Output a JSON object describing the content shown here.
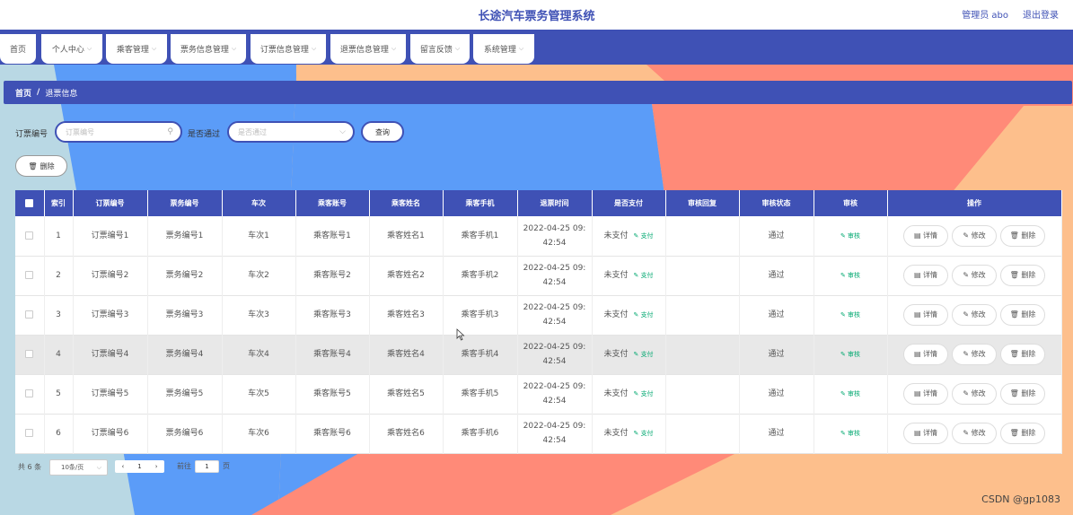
{
  "header": {
    "app_title": "长途汽车票务管理系统",
    "user_info": "管理员 abo",
    "logout": "退出登录"
  },
  "nav": {
    "items": [
      {
        "label": "首页"
      },
      {
        "label": "个人中心"
      },
      {
        "label": "乘客管理"
      },
      {
        "label": "票务信息管理"
      },
      {
        "label": "订票信息管理"
      },
      {
        "label": "退票信息管理"
      },
      {
        "label": "留言反馈"
      },
      {
        "label": "系统管理"
      }
    ]
  },
  "breadcrumb": {
    "home": "首页",
    "separator": "/",
    "current": "退票信息"
  },
  "search": {
    "order_label": "订票编号",
    "order_placeholder": "订票编号",
    "pass_label": "是否通过",
    "pass_placeholder": "是否通过",
    "query_button": "查询",
    "delete_button": "删除"
  },
  "table": {
    "columns": [
      "索引",
      "订票编号",
      "票务编号",
      "车次",
      "乘客账号",
      "乘客姓名",
      "乘客手机",
      "退票时间",
      "是否支付",
      "审核回复",
      "审核状态",
      "审核",
      "操作"
    ],
    "pay_button": "支付",
    "audit_button": "审核",
    "detail_button": "详情",
    "edit_button": "修改",
    "delete_button": "删除",
    "rows": [
      {
        "index": "1",
        "order_no": "订票编号1",
        "ticket_no": "票务编号1",
        "trip": "车次1",
        "account": "乘客账号1",
        "name": "乘客姓名1",
        "phone": "乘客手机1",
        "time_a": "2022-04-25 09:",
        "time_b": "42:54",
        "paid": "未支付",
        "reply": "",
        "status": "通过"
      },
      {
        "index": "2",
        "order_no": "订票编号2",
        "ticket_no": "票务编号2",
        "trip": "车次2",
        "account": "乘客账号2",
        "name": "乘客姓名2",
        "phone": "乘客手机2",
        "time_a": "2022-04-25 09:",
        "time_b": "42:54",
        "paid": "未支付",
        "reply": "",
        "status": "通过"
      },
      {
        "index": "3",
        "order_no": "订票编号3",
        "ticket_no": "票务编号3",
        "trip": "车次3",
        "account": "乘客账号3",
        "name": "乘客姓名3",
        "phone": "乘客手机3",
        "time_a": "2022-04-25 09:",
        "time_b": "42:54",
        "paid": "未支付",
        "reply": "",
        "status": "通过"
      },
      {
        "index": "4",
        "order_no": "订票编号4",
        "ticket_no": "票务编号4",
        "trip": "车次4",
        "account": "乘客账号4",
        "name": "乘客姓名4",
        "phone": "乘客手机4",
        "time_a": "2022-04-25 09:",
        "time_b": "42:54",
        "paid": "未支付",
        "reply": "",
        "status": "通过"
      },
      {
        "index": "5",
        "order_no": "订票编号5",
        "ticket_no": "票务编号5",
        "trip": "车次5",
        "account": "乘客账号5",
        "name": "乘客姓名5",
        "phone": "乘客手机5",
        "time_a": "2022-04-25 09:",
        "time_b": "42:54",
        "paid": "未支付",
        "reply": "",
        "status": "通过"
      },
      {
        "index": "6",
        "order_no": "订票编号6",
        "ticket_no": "票务编号6",
        "trip": "车次6",
        "account": "乘客账号6",
        "name": "乘客姓名6",
        "phone": "乘客手机6",
        "time_a": "2022-04-25 09:",
        "time_b": "42:54",
        "paid": "未支付",
        "reply": "",
        "status": "通过"
      }
    ]
  },
  "pagination": {
    "total": "共 6 条",
    "page_size": "10条/页",
    "current_page": "1",
    "goto_label": "前往",
    "goto_value": "1",
    "unit": "页"
  },
  "watermark": "CSDN @gp1083",
  "colors": {
    "primary": "#3f51b5",
    "bg_blue": "#5b9cf8",
    "bg_salmon": "#ff8a78",
    "bg_peach": "#fdbf8c",
    "bg_lightblue": "#b9d8e4",
    "success": "#00a870"
  }
}
